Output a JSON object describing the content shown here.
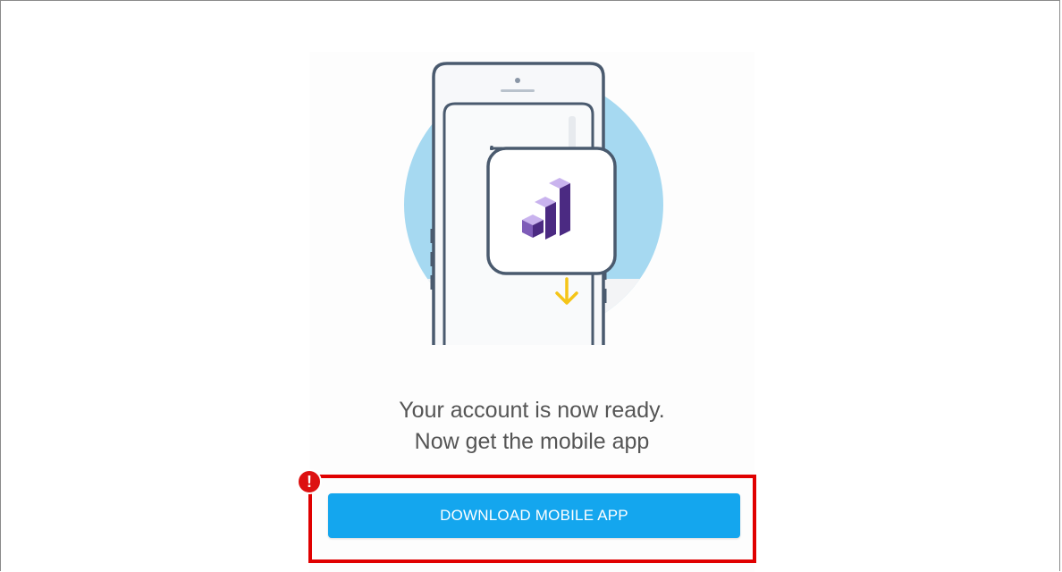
{
  "onboarding": {
    "message_line1": "Your account is now ready.",
    "message_line2": "Now get the mobile app",
    "download_button_label": "DOWNLOAD MOBILE APP",
    "warning_badge": "!"
  },
  "colors": {
    "button": "#14a6ee",
    "highlight": "#e00000",
    "circle": "#a6d9f1",
    "phone_outline": "#4a5a6e",
    "logo_light": "#c9b3ee",
    "logo_dark": "#4b2a82",
    "arrow": "#f5c518"
  },
  "icons": {
    "illustration": "phone-download-illustration",
    "app_logo": "bar-chart-logo-icon",
    "arrow": "download-arrow-icon",
    "badge": "exclamation-icon"
  }
}
